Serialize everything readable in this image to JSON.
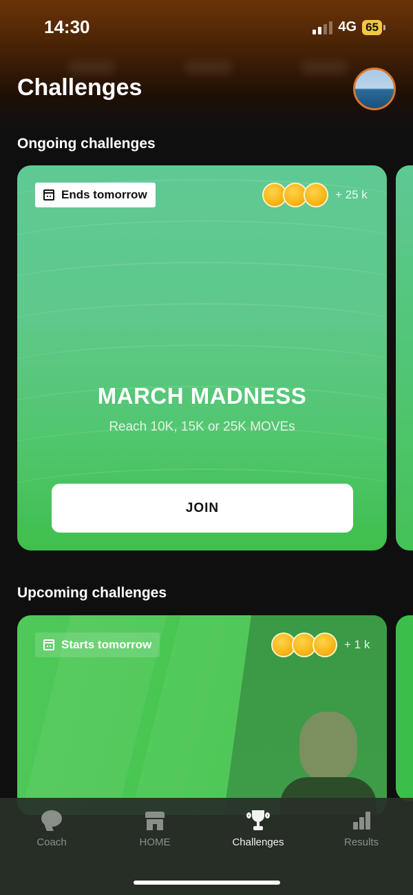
{
  "status_bar": {
    "time": "14:30",
    "network": "4G",
    "battery": "65"
  },
  "header": {
    "title": "Challenges"
  },
  "sections": {
    "ongoing": {
      "title": "Ongoing challenges",
      "card": {
        "date_label": "Ends tomorrow",
        "participants": "+ 25 k",
        "name": "MARCH MADNESS",
        "description": "Reach 10K, 15K or 25K MOVEs",
        "button": "JOIN"
      }
    },
    "upcoming": {
      "title": "Upcoming challenges",
      "card": {
        "date_label": "Starts tomorrow",
        "participants": "+ 1 k"
      }
    }
  },
  "tabs": [
    {
      "label": "Coach",
      "icon": "chat-bubble-icon",
      "active": false
    },
    {
      "label": "HOME",
      "icon": "store-icon",
      "active": false
    },
    {
      "label": "Challenges",
      "icon": "trophy-icon",
      "active": true
    },
    {
      "label": "Results",
      "icon": "bar-chart-icon",
      "active": false
    }
  ],
  "colors": {
    "card_green_top": "#5fc994",
    "card_green_bottom": "#3fbf4c",
    "coin": "#f7b516",
    "avatar_ring": "#d9772a",
    "battery": "#f2c744"
  }
}
